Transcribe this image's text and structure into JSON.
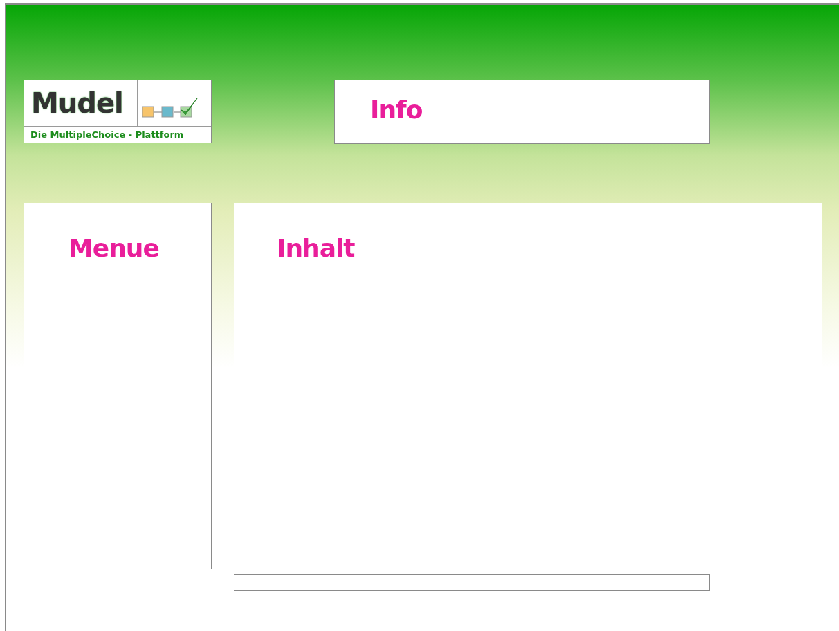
{
  "logo": {
    "title": "Mudel",
    "tagline": "Die MultipleChoice - Plattform"
  },
  "info": {
    "title": "Info"
  },
  "menu": {
    "title": "Menue"
  },
  "content": {
    "title": "Inhalt"
  }
}
